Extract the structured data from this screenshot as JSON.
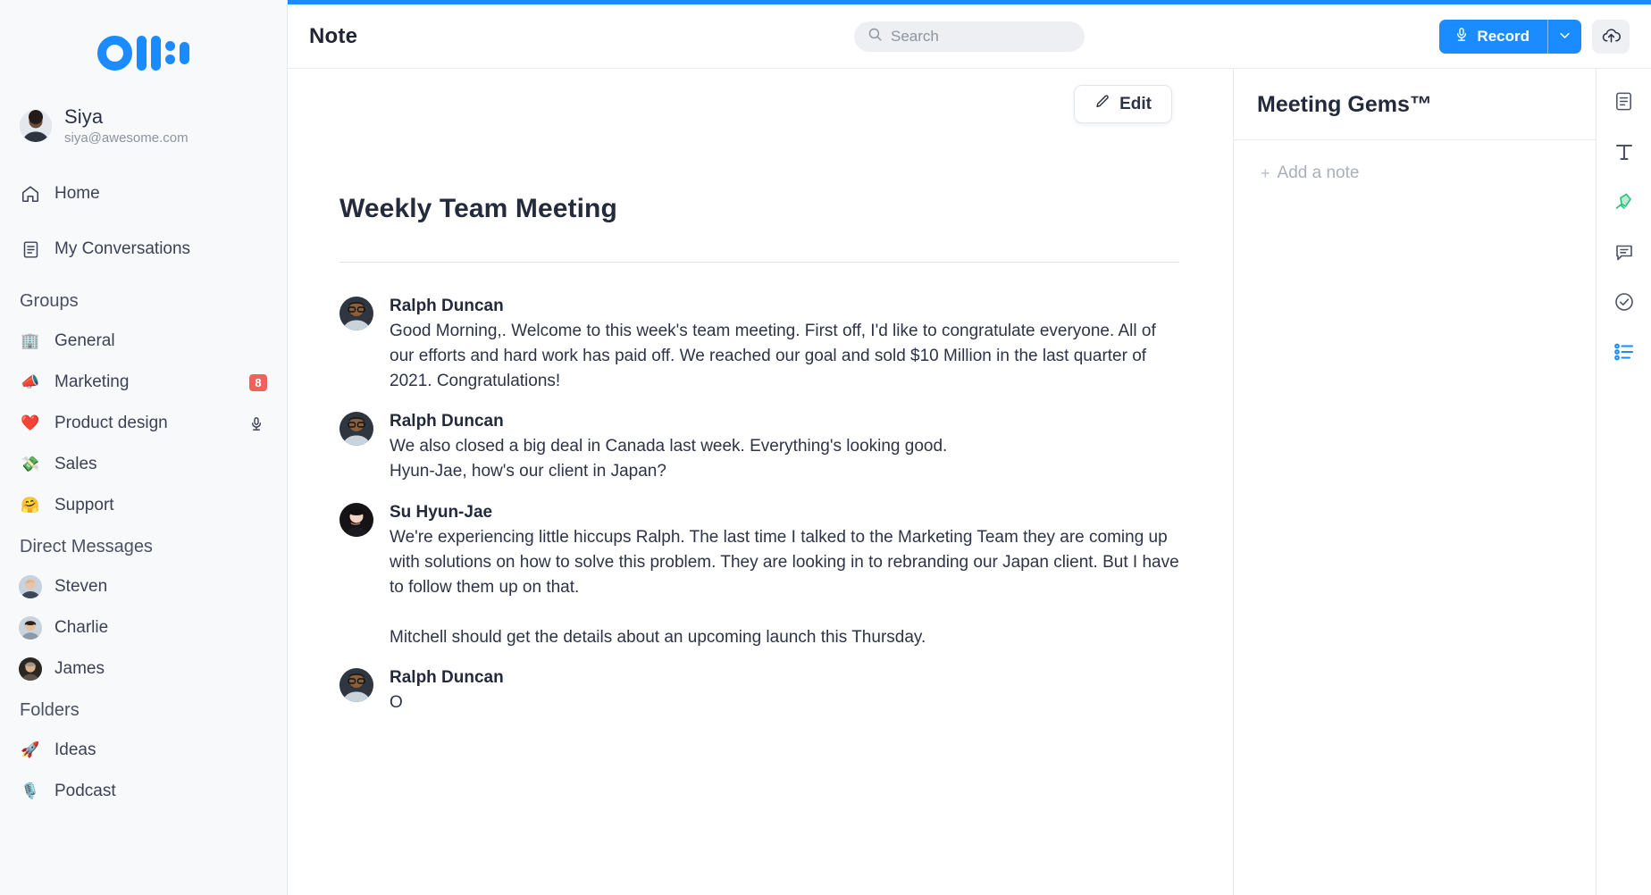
{
  "brand": {
    "logo_name": "otter-logo",
    "accent_color": "#1a8cff",
    "badge_color": "#f0615e",
    "gem_color": "#2ec27e"
  },
  "sidebar": {
    "user": {
      "name": "Siya",
      "email": "siya@awesome.com",
      "avatar_name": "user-avatar"
    },
    "primary_nav": [
      {
        "label": "Home",
        "icon": "home-icon"
      },
      {
        "label": "My Conversations",
        "icon": "document-icon"
      }
    ],
    "groups_heading": "Groups",
    "groups": [
      {
        "label": "General",
        "emoji": "🏢",
        "badge": "",
        "mic": false
      },
      {
        "label": "Marketing",
        "emoji": "📣",
        "badge": "8",
        "mic": false
      },
      {
        "label": "Product design",
        "emoji": "❤️",
        "badge": "",
        "mic": true
      },
      {
        "label": "Sales",
        "emoji": "💸",
        "badge": "",
        "mic": false
      },
      {
        "label": "Support",
        "emoji": "🤗",
        "badge": "",
        "mic": false
      }
    ],
    "dm_heading": "Direct Messages",
    "direct_messages": [
      {
        "label": "Steven"
      },
      {
        "label": "Charlie"
      },
      {
        "label": "James"
      }
    ],
    "folders_heading": "Folders",
    "folders": [
      {
        "label": "Ideas",
        "emoji": "🚀"
      },
      {
        "label": "Podcast",
        "emoji": "🎙️"
      }
    ]
  },
  "topbar": {
    "title": "Note",
    "search_placeholder": "Search",
    "search_value": "",
    "record_label": "Record",
    "record_icon": "microphone-icon",
    "caret_icon": "chevron-down-icon",
    "upload_icon": "cloud-upload-icon"
  },
  "document": {
    "edit_label": "Edit",
    "edit_icon": "pencil-icon",
    "title": "Weekly Team Meeting",
    "messages": [
      {
        "speaker": "Ralph Duncan",
        "text": "Good Morning,. Welcome to this week's team meeting. First off, I'd like to congratulate everyone. All of our efforts and hard work has paid off. We reached our goal and sold $10 Million in the last quarter of 2021. Congratulations!"
      },
      {
        "speaker": "Ralph Duncan",
        "text": "We also closed a big deal in Canada last week. Everything's looking good.\nHyun-Jae, how's our client in Japan?"
      },
      {
        "speaker": "Su Hyun-Jae",
        "text": "We're experiencing little hiccups Ralph. The last time I talked to the Marketing Team they are coming up with solutions on how to solve this problem. They are looking in to rebranding our Japan client. But I have to follow them up on that.\n\nMitchell should get the details about an upcoming launch this Thursday."
      },
      {
        "speaker": "Ralph Duncan",
        "text": "O"
      }
    ]
  },
  "gems": {
    "title": "Meeting Gems™",
    "add_note_label": "Add a note",
    "add_note_plus": "+"
  },
  "rail": {
    "items": [
      {
        "icon": "transcript-document-icon",
        "active": false
      },
      {
        "icon": "text-format-icon",
        "active": false
      },
      {
        "icon": "gem-highlight-icon",
        "active": false
      },
      {
        "icon": "comment-bubble-icon",
        "active": false
      },
      {
        "icon": "check-circle-icon",
        "active": false
      },
      {
        "icon": "bulleted-list-icon",
        "active": true
      }
    ]
  }
}
